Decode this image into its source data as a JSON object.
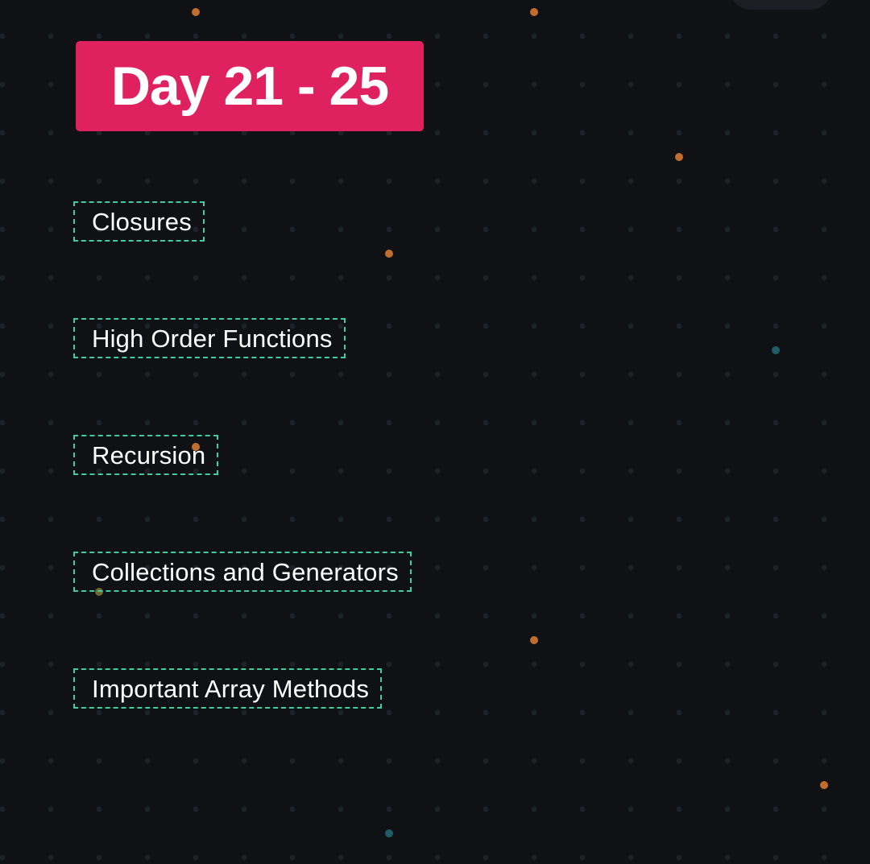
{
  "title": "Day 21 - 25",
  "topics": [
    {
      "label": "Closures"
    },
    {
      "label": "High Order Functions"
    },
    {
      "label": "Recursion"
    },
    {
      "label": "Collections and Generators"
    },
    {
      "label": "Important Array Methods"
    }
  ],
  "colors": {
    "background": "#0f1115",
    "grid_dot": "#1d2129",
    "title_badge": "#e0215f",
    "title_text": "#ffffff",
    "topic_border": "#3ecf9e",
    "topic_text": "#ffffff",
    "accent_dot_orange": "#c06d2e",
    "accent_dot_teal": "#1f5d66"
  }
}
